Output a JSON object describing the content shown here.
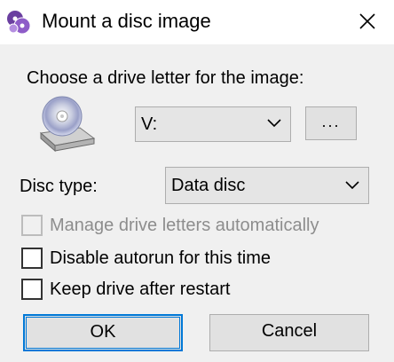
{
  "window": {
    "title": "Mount a disc image",
    "app_icon": "disc-stack-icon",
    "close_icon": "close-icon"
  },
  "drive": {
    "label": "Choose a drive letter for the image:",
    "icon": "cd-drive-icon",
    "selected": "V:",
    "browse_label": "..."
  },
  "disc_type": {
    "label": "Disc type:",
    "selected": "Data disc"
  },
  "options": {
    "manage_letters": {
      "label": "Manage drive letters automatically",
      "checked": false,
      "enabled": false
    },
    "disable_autorun": {
      "label": "Disable autorun for this time",
      "checked": false,
      "enabled": true
    },
    "keep_drive": {
      "label": "Keep drive after restart",
      "checked": false,
      "enabled": true
    }
  },
  "buttons": {
    "ok": "OK",
    "cancel": "Cancel"
  },
  "colors": {
    "accent": "#0078d7",
    "dialog_bg": "#f0f0f0",
    "button_bg": "#e1e1e1",
    "disabled_text": "#8d8d8d"
  }
}
